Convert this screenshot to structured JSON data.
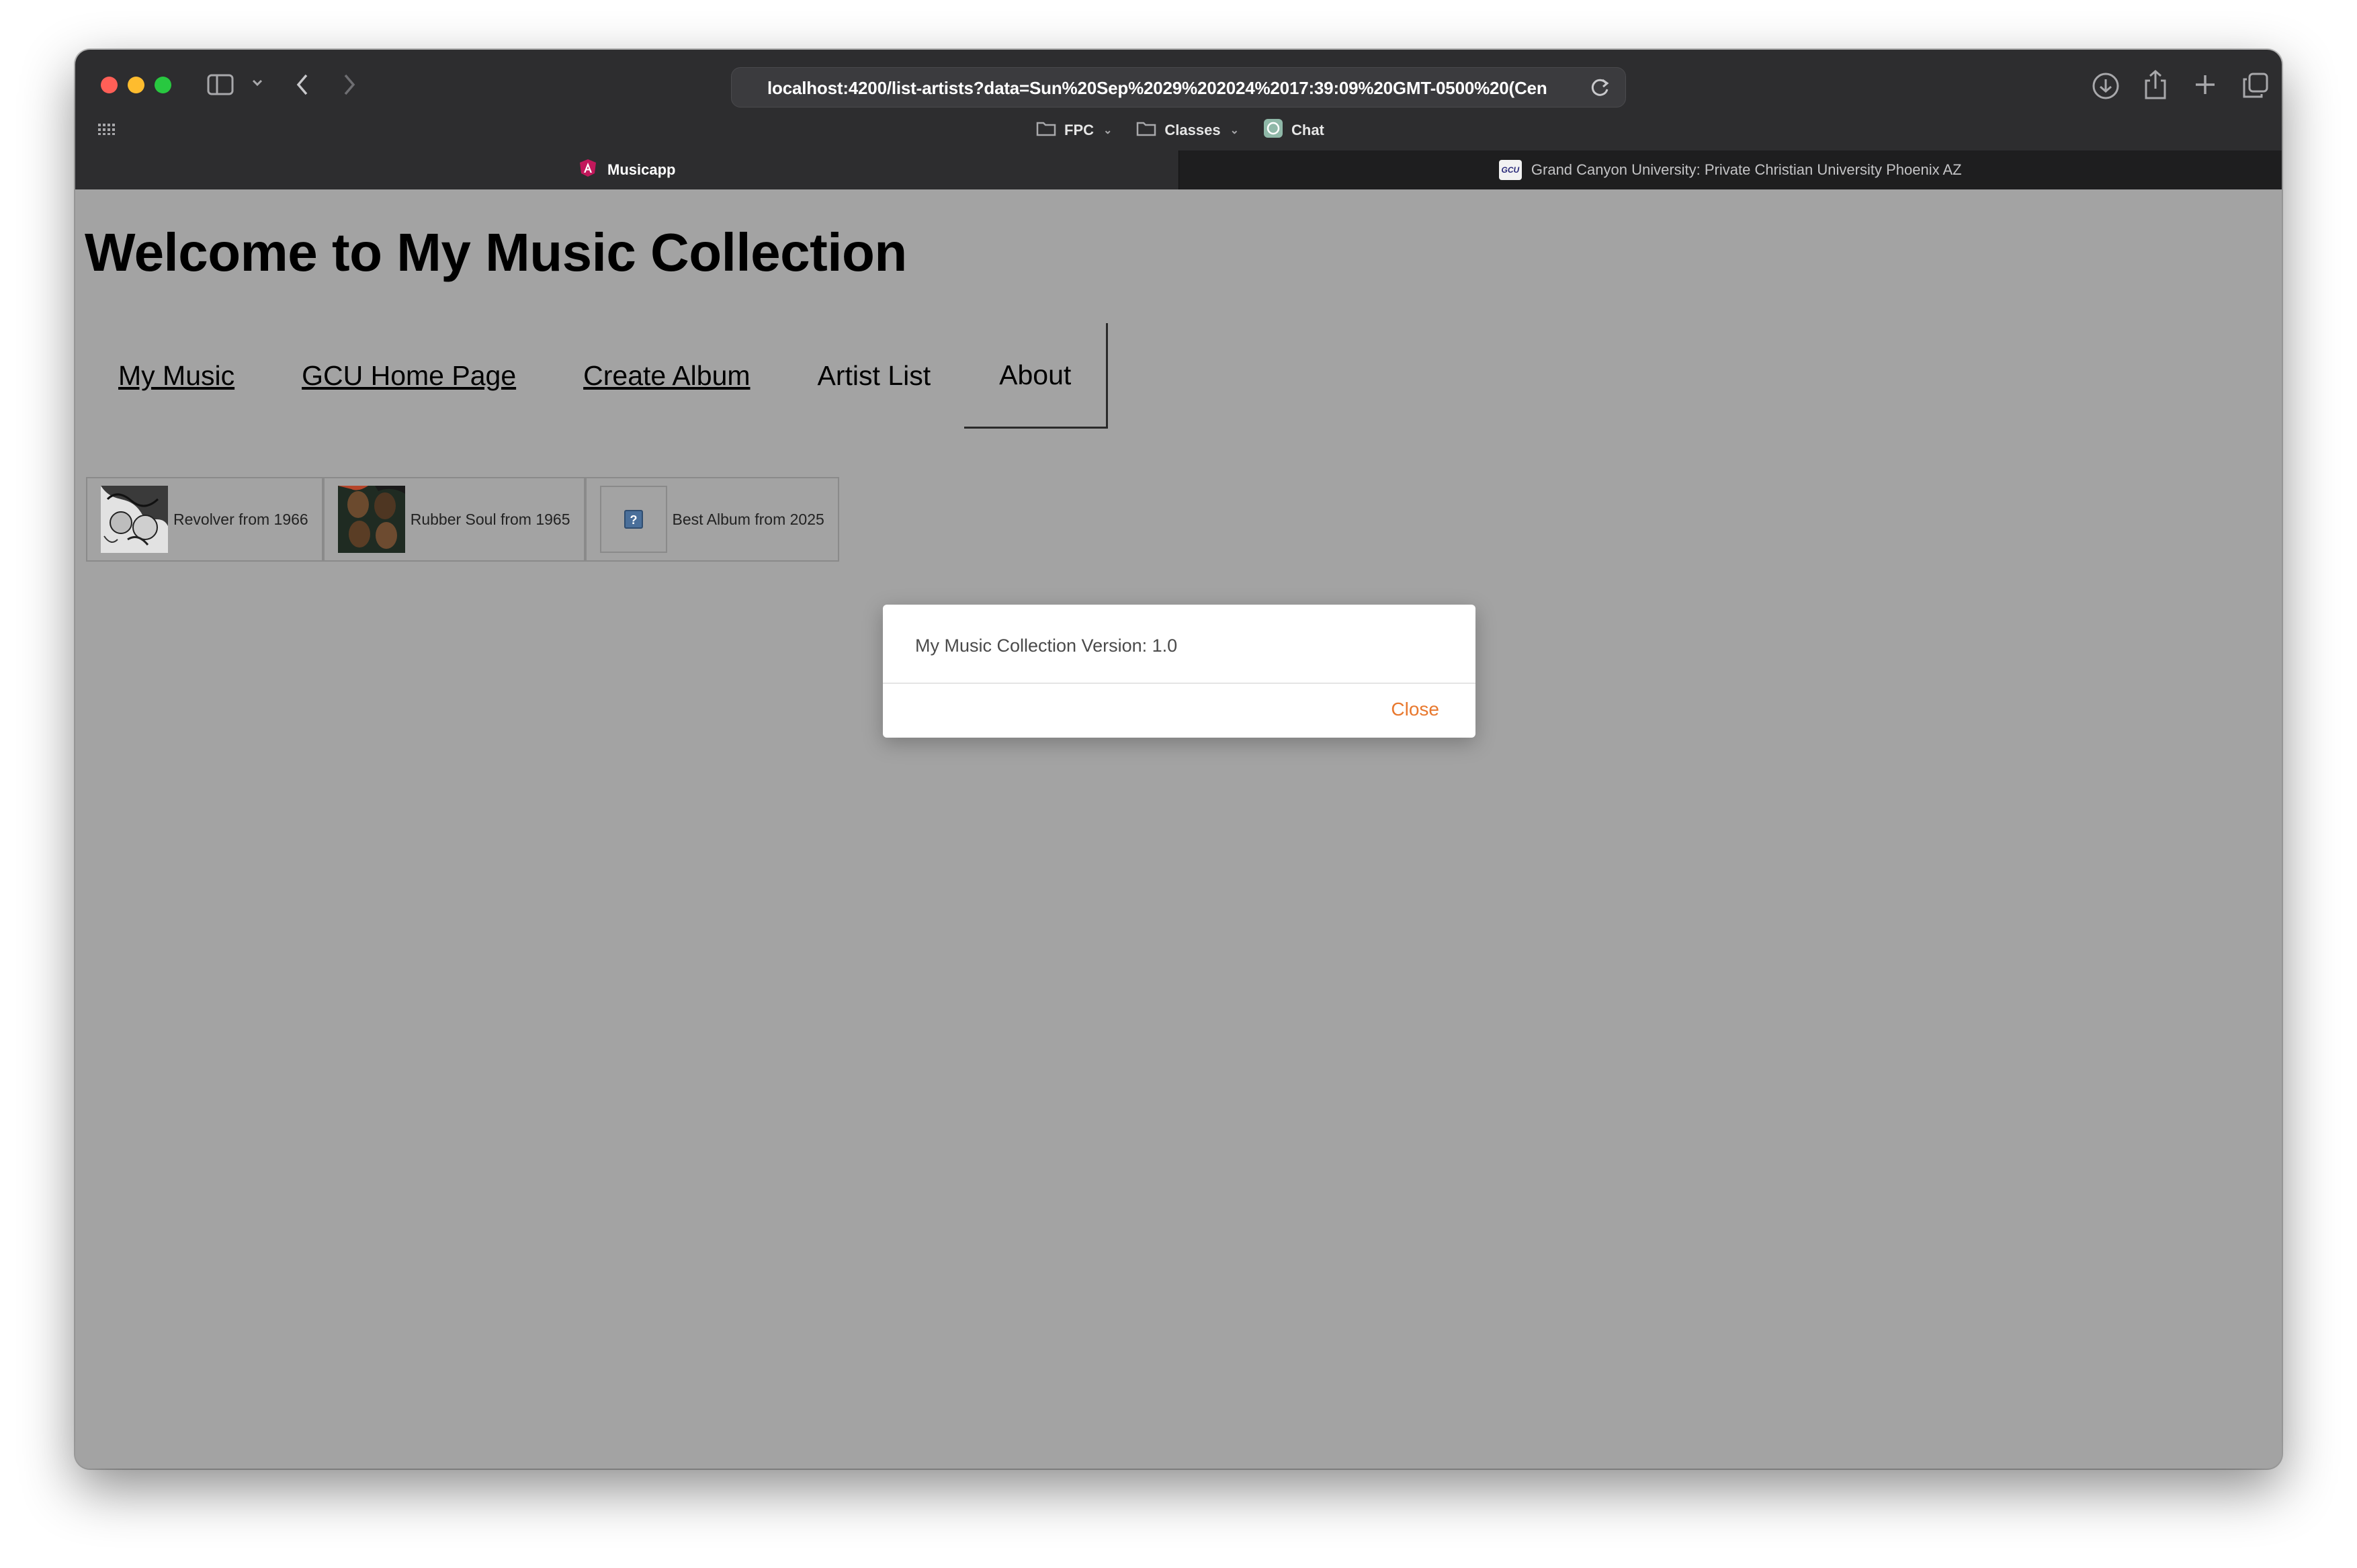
{
  "browser": {
    "url": "localhost:4200/list-artists?data=Sun%20Sep%2029%202024%2017:39:09%20GMT-0500%20(Cen",
    "bookmarks": [
      {
        "label": "FPC",
        "icon": "folder-icon"
      },
      {
        "label": "Classes",
        "icon": "folder-icon"
      },
      {
        "label": "Chat",
        "icon": "chat-favicon"
      }
    ],
    "tabs": [
      {
        "label": "Musicapp",
        "active": true,
        "icon": "angular-favicon"
      },
      {
        "label": "Grand Canyon University: Private Christian University Phoenix AZ",
        "active": false,
        "icon": "gcu-favicon",
        "icon_text": "GCU"
      }
    ]
  },
  "page": {
    "title": "Welcome to My Music Collection",
    "nav": [
      {
        "label": "My Music"
      },
      {
        "label": "GCU Home Page"
      },
      {
        "label": "Create Album"
      },
      {
        "label": "Artist List"
      },
      {
        "label": "About"
      }
    ],
    "albums": [
      {
        "label": "Revolver from 1966",
        "cover": "revolver-cover"
      },
      {
        "label": "Rubber Soul from 1965",
        "cover": "rubber-soul-cover"
      },
      {
        "label": "Best Album from 2025",
        "cover": "missing-image-icon"
      }
    ]
  },
  "modal": {
    "message": "My Music Collection Version: 1.0",
    "close_label": "Close"
  },
  "colors": {
    "toolbar": "#2d2d2f",
    "page_background": "#a3a3a3",
    "modal_close": "#e8782e"
  }
}
